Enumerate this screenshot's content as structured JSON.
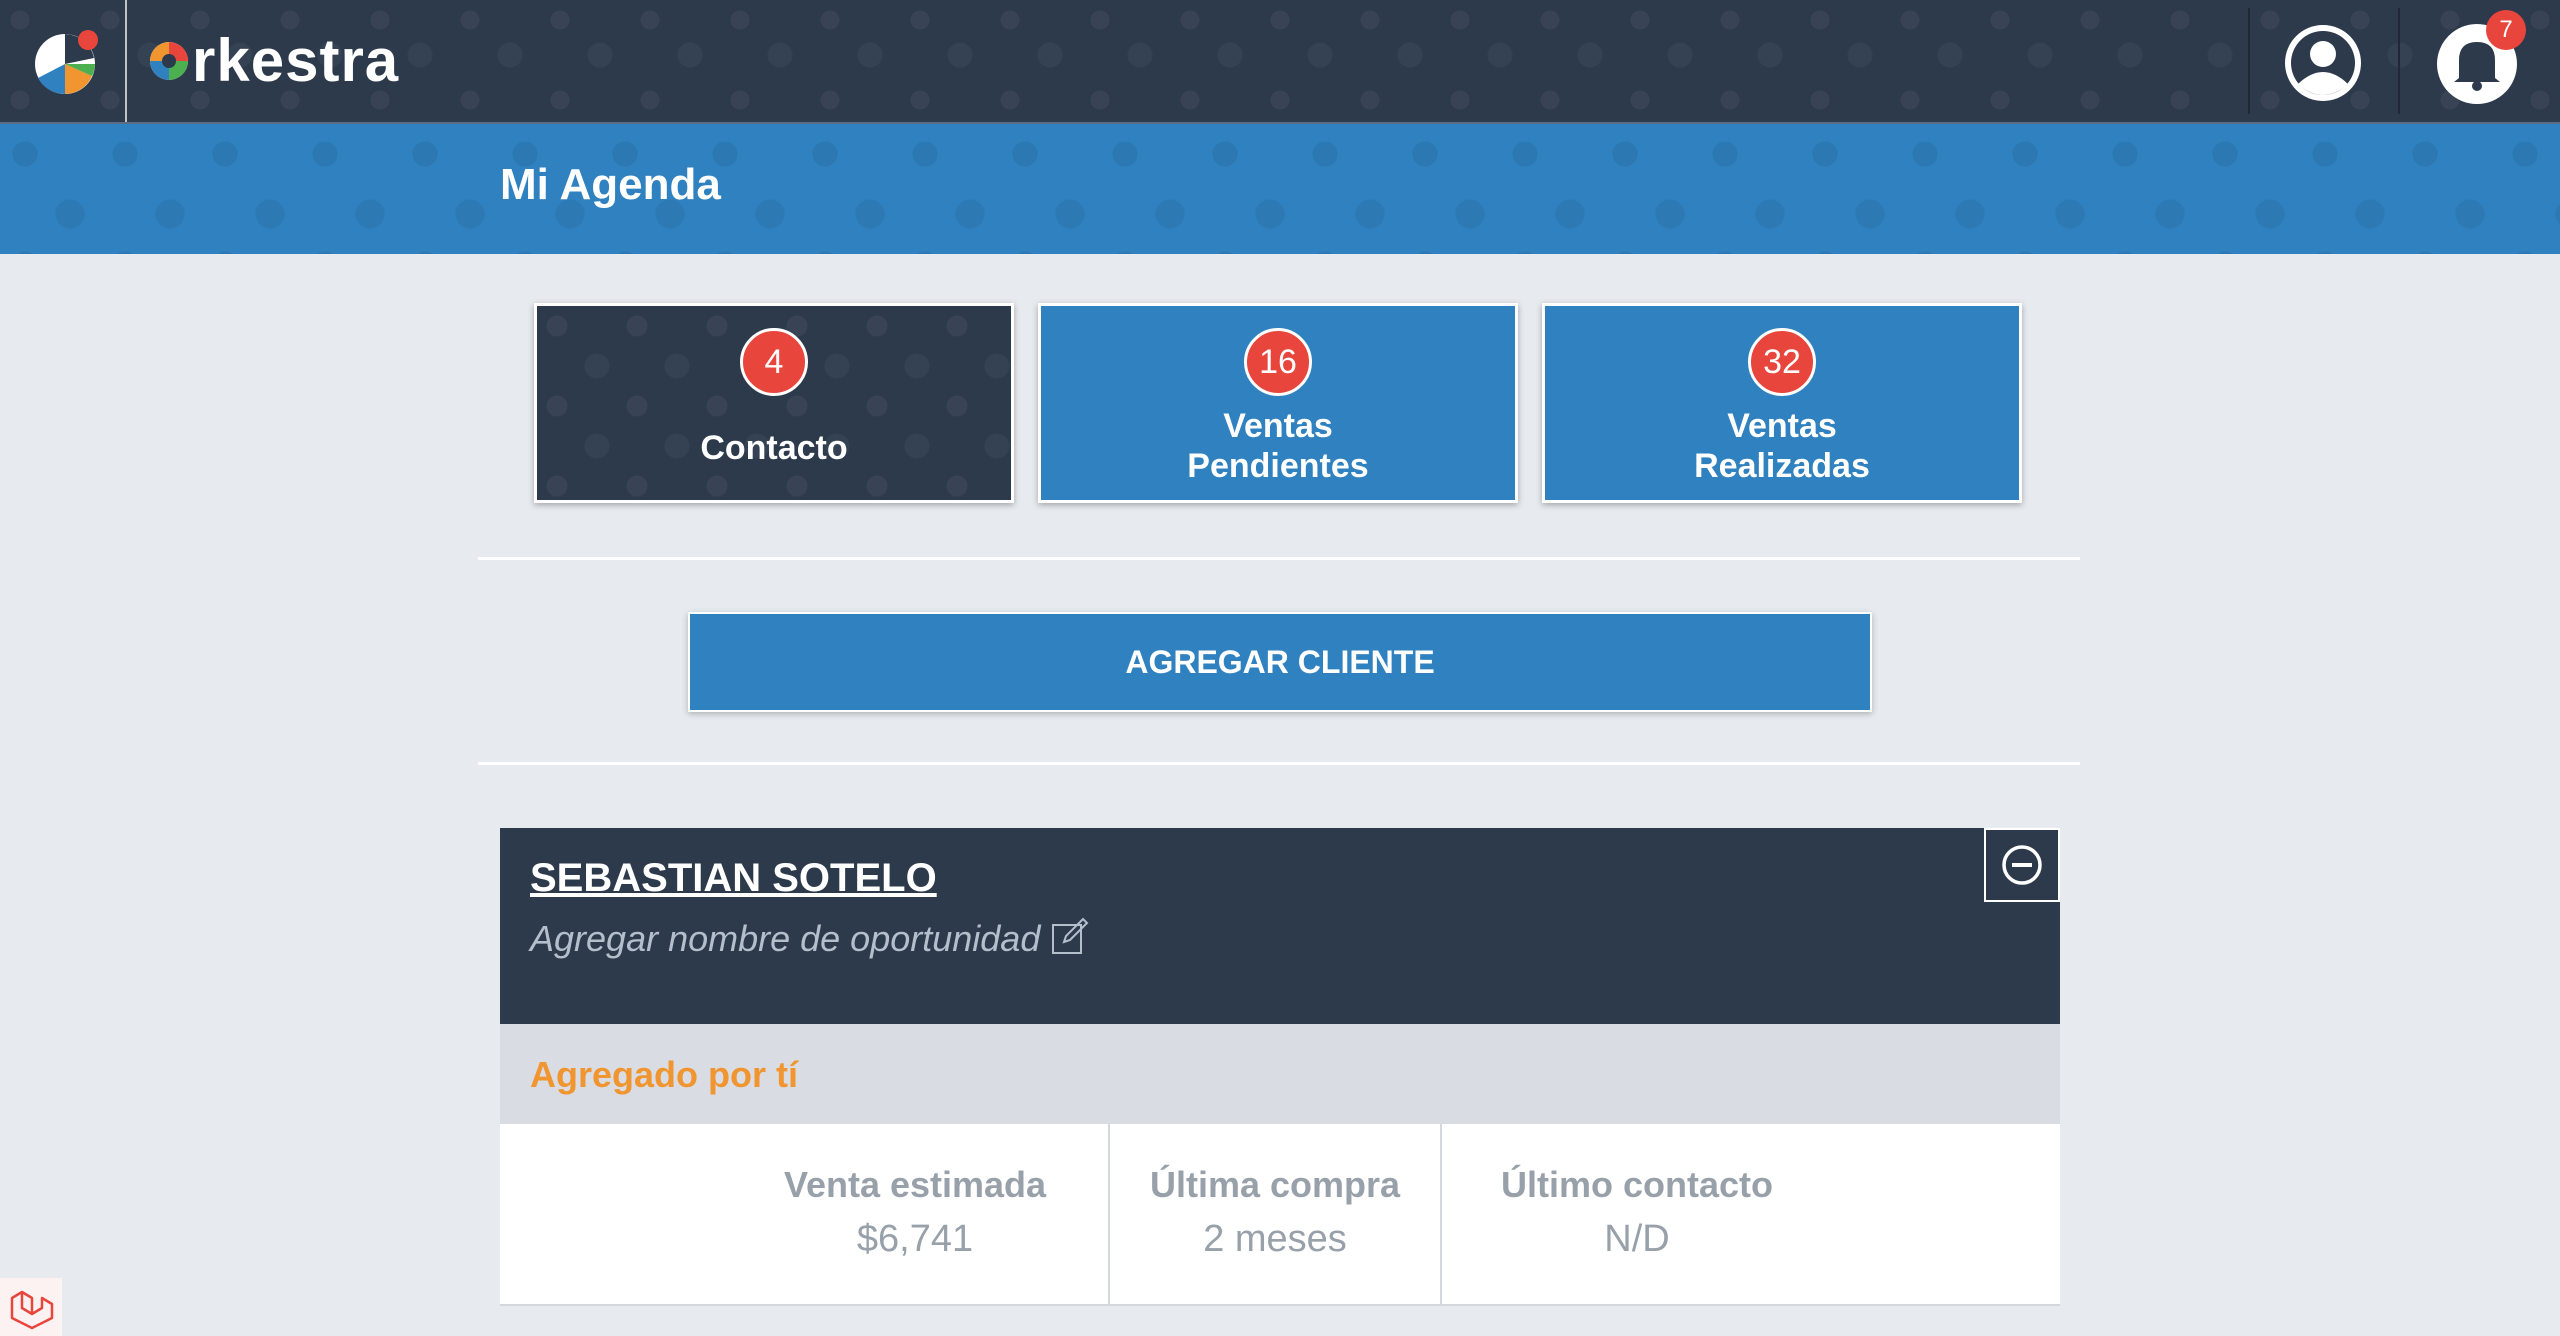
{
  "header": {
    "brand": "rkestra",
    "notification_count": "7"
  },
  "page": {
    "title": "Mi Agenda"
  },
  "cards": [
    {
      "count": "4",
      "label": "Contacto",
      "active": true
    },
    {
      "count": "16",
      "label_line1": "Ventas",
      "label_line2": "Pendientes"
    },
    {
      "count": "32",
      "label_line1": "Ventas",
      "label_line2": "Realizadas"
    }
  ],
  "actions": {
    "add_client": "AGREGAR CLIENTE"
  },
  "client": {
    "name": "SEBASTIAN SOTELO",
    "opportunity_placeholder": "Agregar nombre de oportunidad",
    "added_by": "Agregado por tí",
    "stats": [
      {
        "label": "Venta estimada",
        "value": "$6,741"
      },
      {
        "label": "Última compra",
        "value": "2 meses"
      },
      {
        "label": "Último contacto",
        "value": "N/D"
      }
    ]
  },
  "colors": {
    "navy": "#2d3a4c",
    "blue": "#2f81bf",
    "badge_red": "#e8453c",
    "orange": "#f0952f"
  }
}
